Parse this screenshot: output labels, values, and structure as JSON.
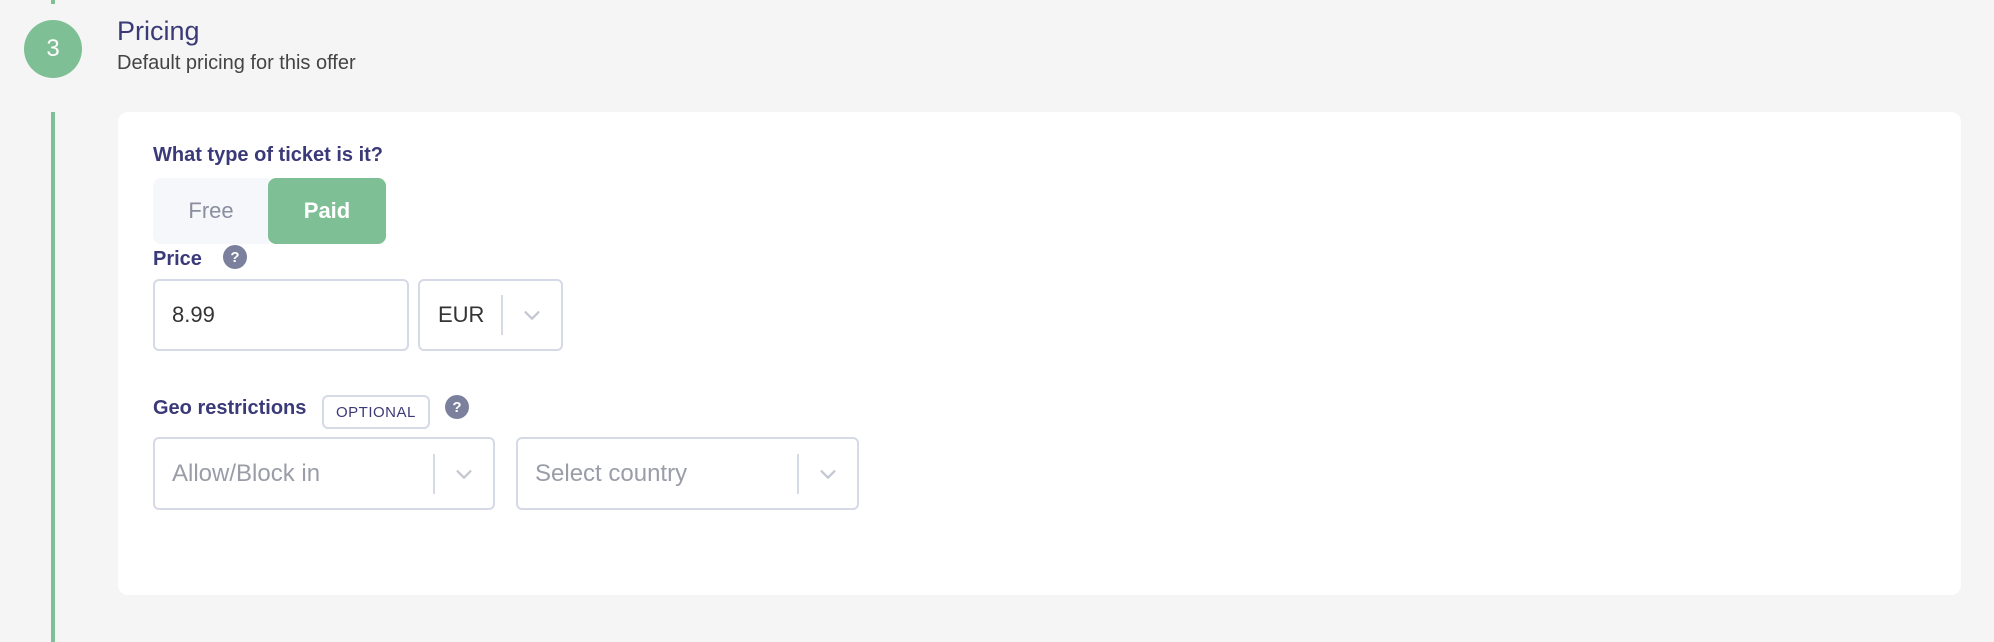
{
  "step": {
    "number": "3",
    "title": "Pricing",
    "subtitle": "Default pricing for this offer"
  },
  "ticket_type": {
    "label": "What type of ticket is it?",
    "options": [
      "Free",
      "Paid"
    ],
    "selected": "Paid"
  },
  "price": {
    "label": "Price",
    "help": "?",
    "value": "8.99",
    "currency": "EUR"
  },
  "geo": {
    "label": "Geo restrictions",
    "badge": "OPTIONAL",
    "help": "?",
    "mode_placeholder": "Allow/Block in",
    "country_placeholder": "Select country"
  },
  "colors": {
    "accent": "#7fbf95",
    "heading": "#3b3a78",
    "border": "#d6d9e6"
  },
  "icons": {
    "help": "question-circle-icon",
    "dropdown": "chevron-down-icon"
  }
}
